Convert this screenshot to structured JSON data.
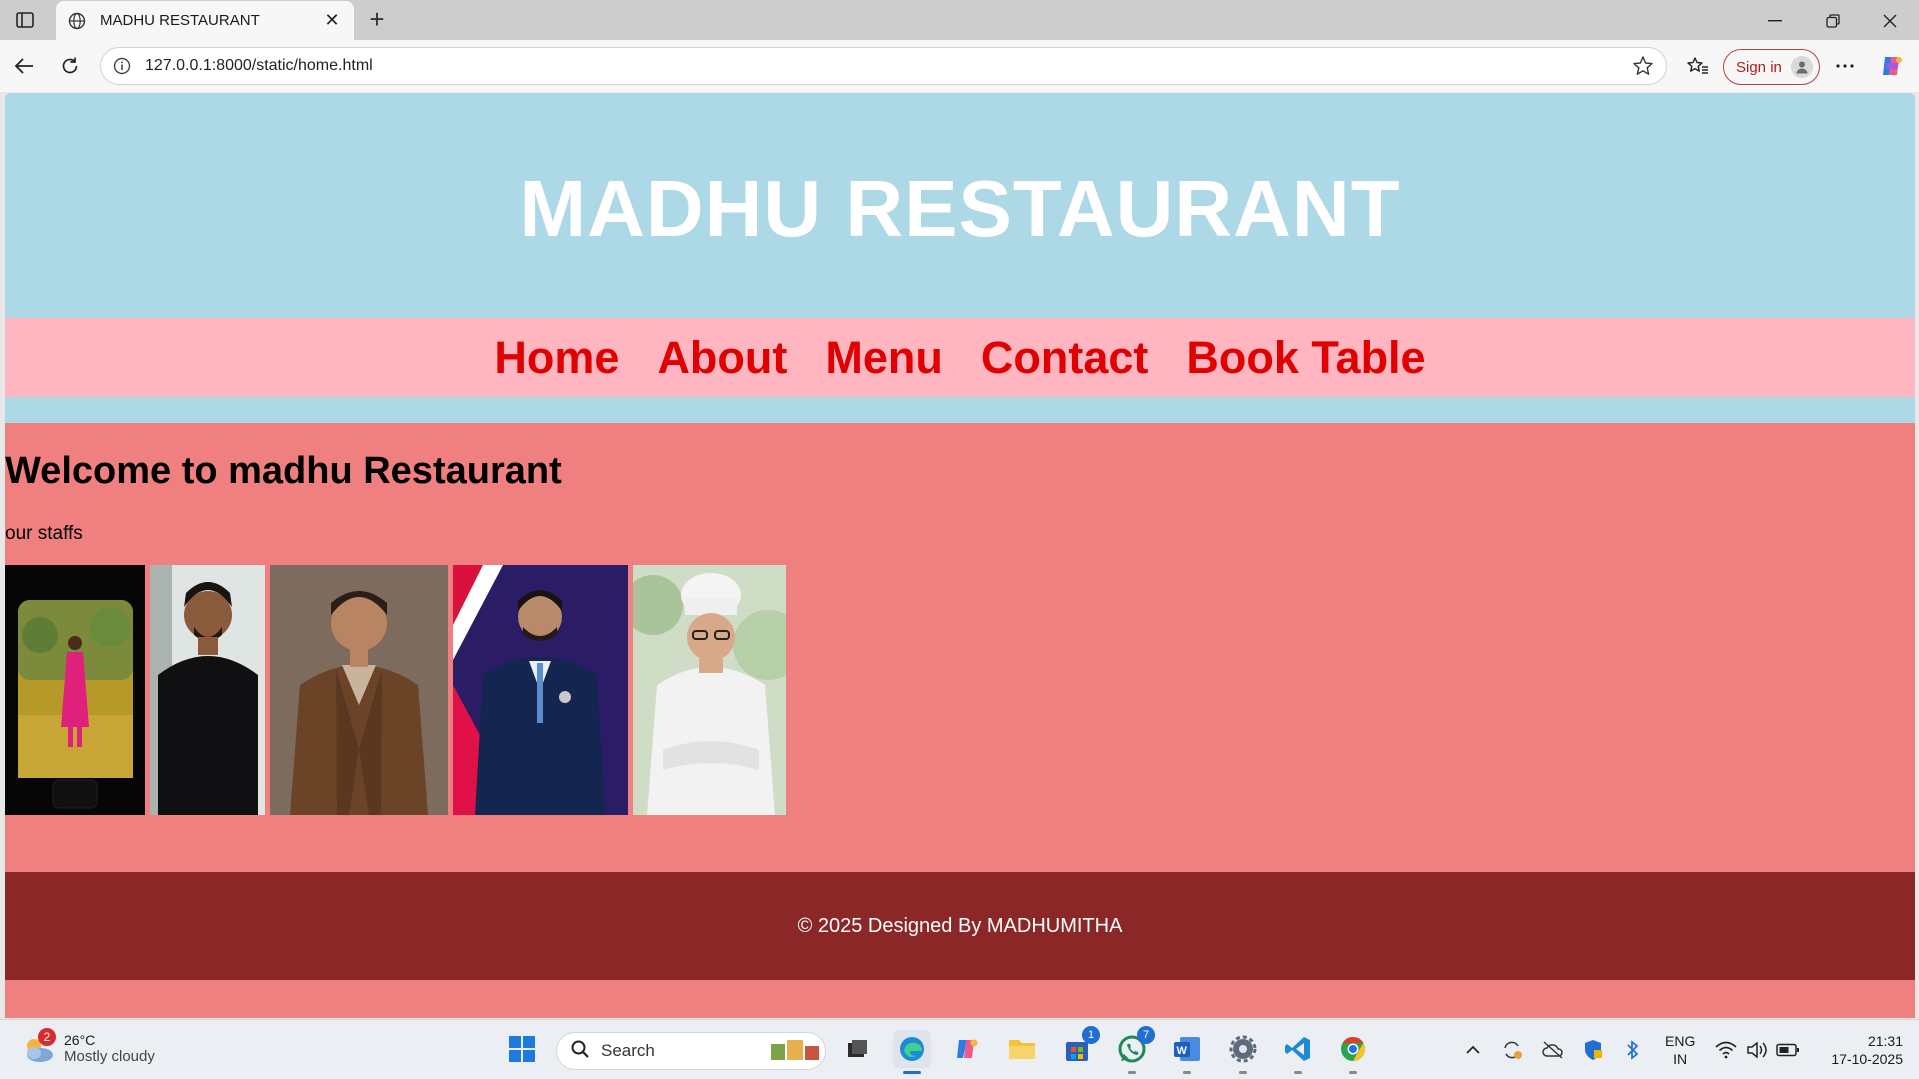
{
  "browser": {
    "tab_title": "MADHU RESTAURANT",
    "url": "127.0.0.1:8000/static/home.html",
    "sign_in_label": "Sign in"
  },
  "site": {
    "title": "MADHU RESTAURANT",
    "nav": [
      "Home",
      "About",
      "Menu",
      "Contact",
      "Book Table"
    ],
    "heading": "Welcome to madhu Restaurant",
    "subheading": "our staffs",
    "footer": "© 2025 Designed By MADHUMITHA",
    "colors": {
      "header_bg": "#add8e6",
      "nav_bg": "#ffb6c1",
      "nav_link": "#e00000",
      "main_bg": "#f08080",
      "footer_bg": "#8b2727"
    }
  },
  "taskbar": {
    "weather_badge": "2",
    "temperature": "26°C",
    "condition": "Mostly cloudy",
    "search_label": "Search",
    "store_badge": "1",
    "whatsapp_badge": "7",
    "lang_line1": "ENG",
    "lang_line2": "IN",
    "time": "21:31",
    "date": "17-10-2025"
  }
}
